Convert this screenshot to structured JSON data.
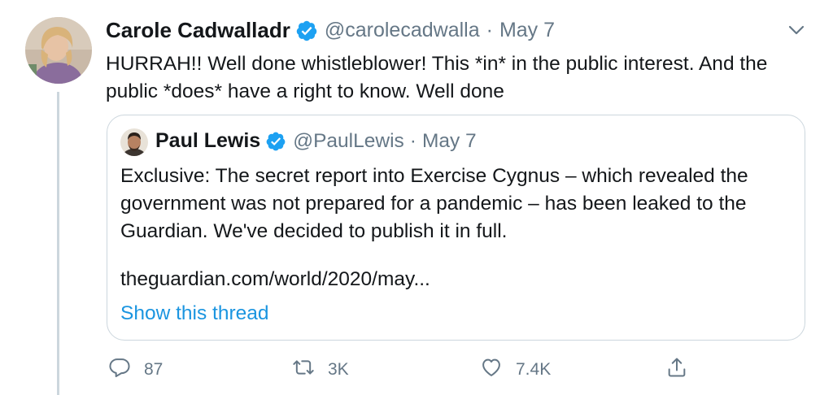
{
  "tweet": {
    "author_name": "Carole Cadwalladr",
    "author_handle": "@carolecadwalla",
    "separator": "·",
    "date": "May 7",
    "text": "HURRAH!! Well done whistleblower! This *in* in the public interest. And the public *does* have a right to know. Well done"
  },
  "quoted_tweet": {
    "author_name": "Paul Lewis",
    "author_handle": "@PaulLewis",
    "separator": "·",
    "date": "May 7",
    "text": "Exclusive: The secret report into Exercise Cygnus – which revealed the government was not prepared for a pandemic – has been leaked to the Guardian. We've decided to publish it in full.",
    "link": "theguardian.com/world/2020/may...",
    "show_thread": "Show this thread"
  },
  "actions": {
    "reply_count": "87",
    "retweet_count": "3K",
    "like_count": "7.4K"
  },
  "icons": {
    "verified": "verified-badge-icon",
    "more": "chevron-down-icon",
    "reply": "reply-icon",
    "retweet": "retweet-icon",
    "like": "heart-icon",
    "share": "share-icon"
  },
  "colors": {
    "accent": "#1b95e0",
    "verified": "#1da1f2",
    "muted": "#657786",
    "border": "#ccd6dd",
    "text": "#14171a"
  }
}
